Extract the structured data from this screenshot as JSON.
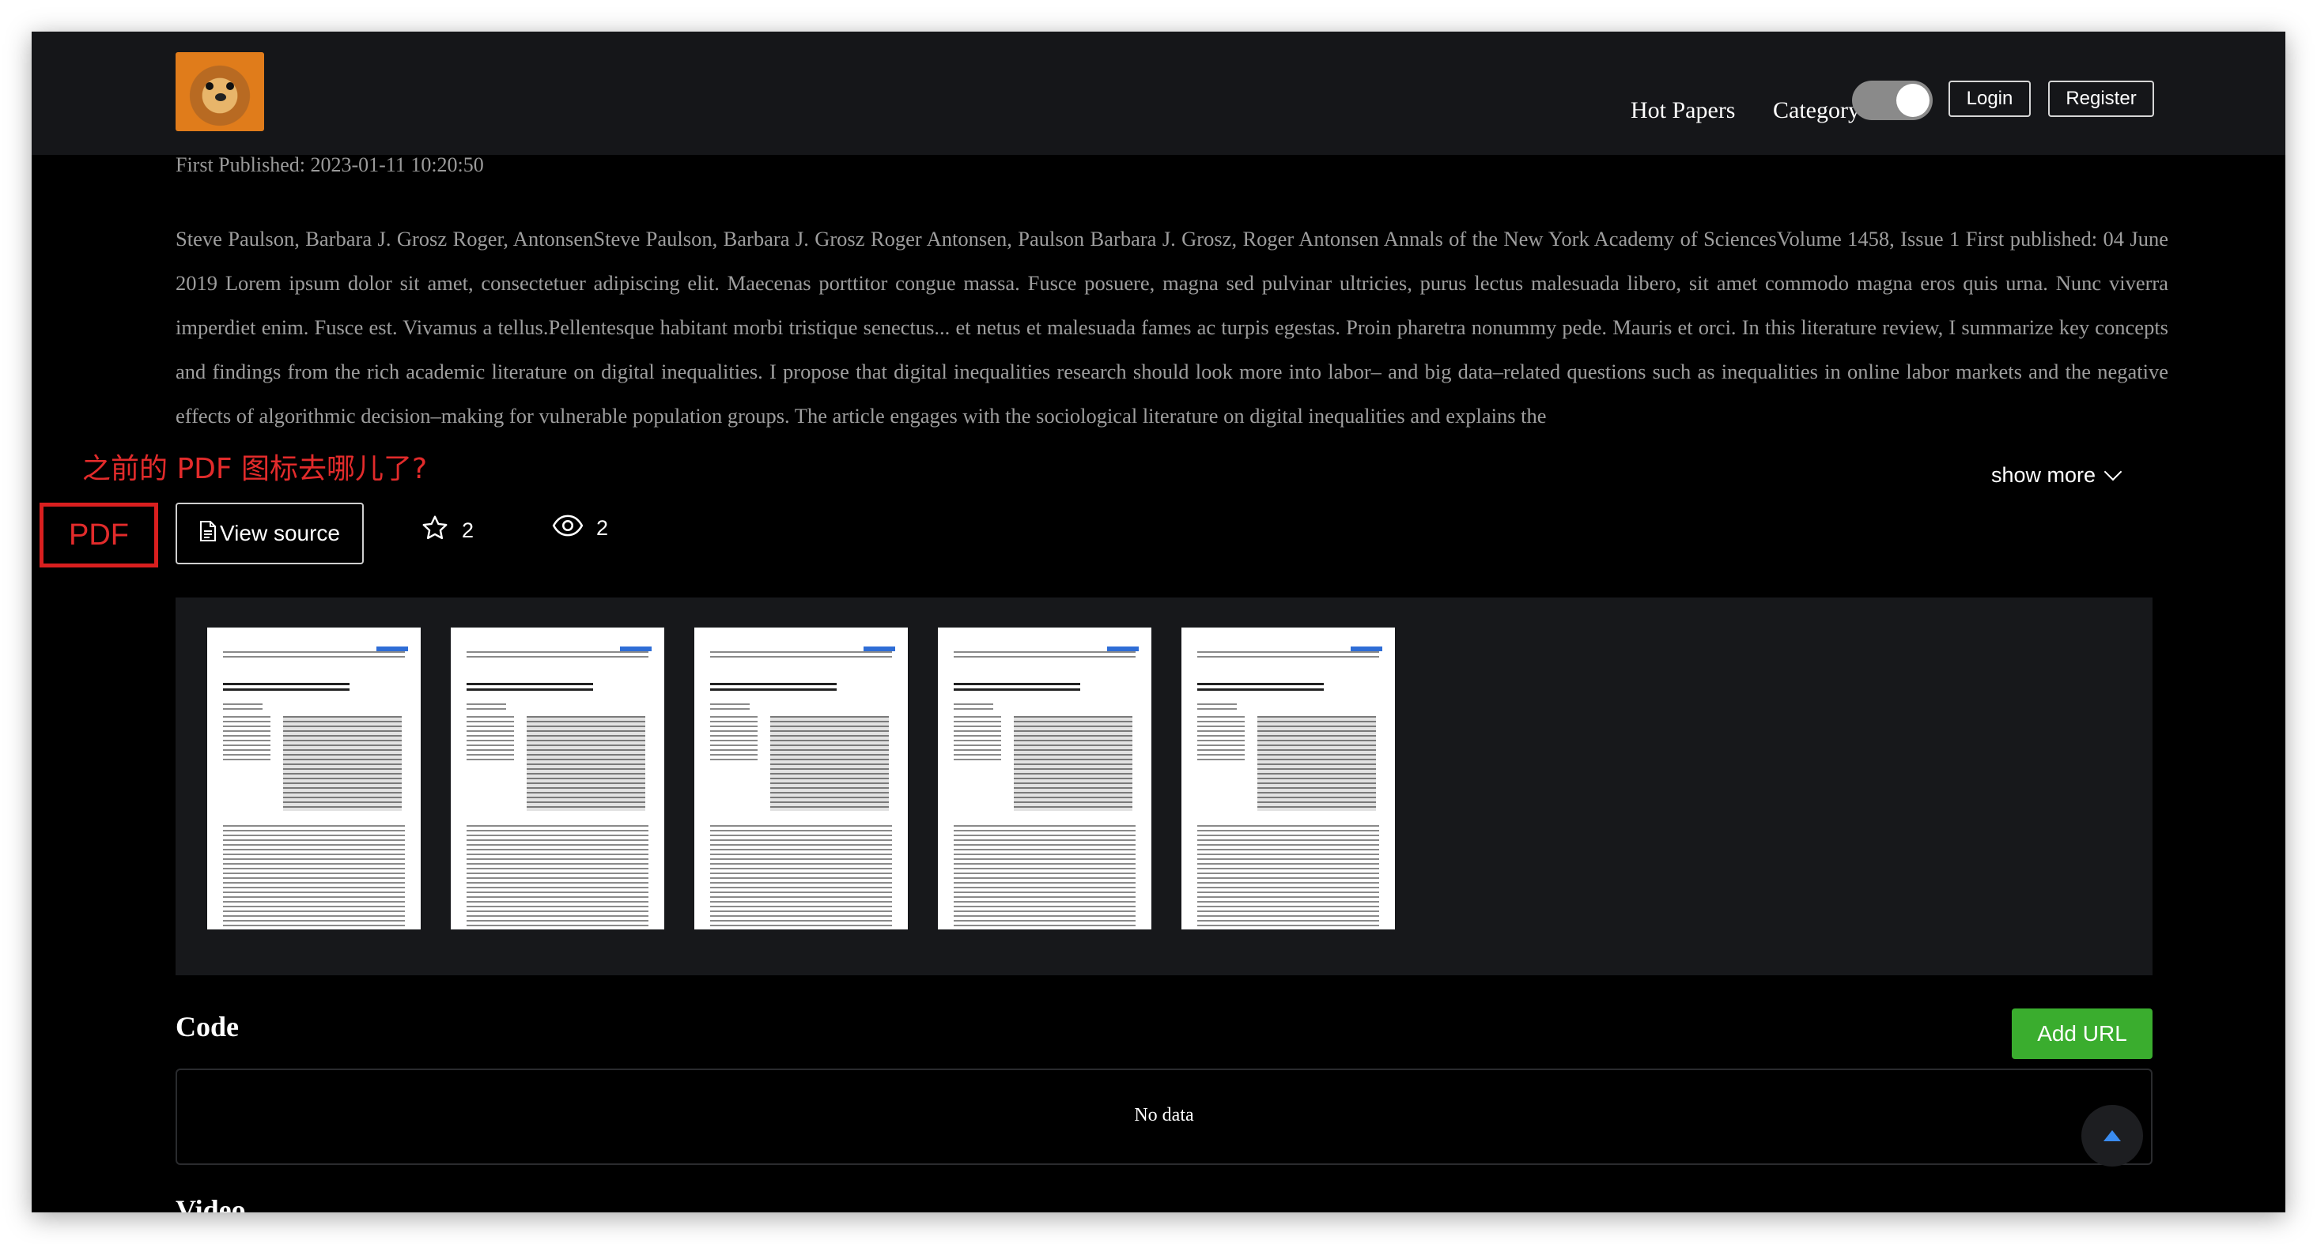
{
  "header": {
    "nav": [
      "Hot Papers",
      "Category"
    ],
    "login_label": "Login",
    "register_label": "Register",
    "theme_toggle_on": true
  },
  "paper": {
    "published": "First Published: 2023-01-11 10:20:50",
    "abstract": "Steve Paulson, Barbara J. Grosz Roger, AntonsenSteve Paulson, Barbara J. Grosz Roger Antonsen, Paulson Barbara J. Grosz, Roger Antonsen Annals of the New York Academy of SciencesVolume 1458, Issue 1 First published: 04 June 2019 Lorem ipsum dolor sit amet, consectetuer adipiscing elit. Maecenas porttitor congue massa. Fusce posuere, magna sed pulvinar ultricies, purus lectus malesuada libero, sit amet commodo magna eros quis urna. Nunc viverra imperdiet enim. Fusce est. Vivamus a tellus.Pellentesque habitant morbi tristique senectus... et netus et malesuada fames ac turpis egestas. Proin pharetra nonummy pede. Mauris et orci. In this literature review, I summarize key concepts and findings from the rich academic literature on digital inequalities. I propose that digital inequalities research should look more into labor– and big data–related questions such as inequalities in online labor markets and the negative effects of algorithmic decision–making for vulnerable population groups. The article engages with the sociological literature on digital inequalities and explains the",
    "show_more": "show more"
  },
  "annotation": {
    "text": "之前的 PDF 图标去哪儿了?",
    "pdf_label": "PDF"
  },
  "actions": {
    "view_source": "View source",
    "stars": "2",
    "views": "2"
  },
  "gallery": {
    "page_count": 5
  },
  "code_section": {
    "title": "Code",
    "add_url": "Add URL",
    "empty": "No data"
  },
  "video_section": {
    "title": "Video"
  },
  "colors": {
    "background": "#000000",
    "header": "#151619",
    "accent_green": "#3aad2e",
    "annotation_red": "#e22b2b",
    "scroll_top_arrow": "#3a8cf0"
  },
  "icons": [
    "document-icon",
    "star-icon",
    "eye-icon",
    "chevron-down-icon",
    "arrow-up-icon"
  ]
}
